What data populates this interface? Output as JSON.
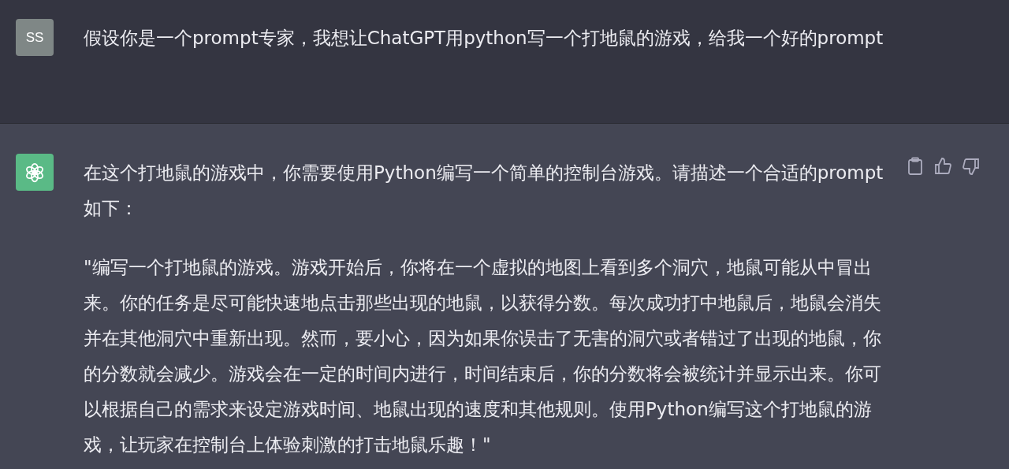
{
  "messages": [
    {
      "kind": "user",
      "avatar": "SS",
      "paragraphs": [
        "假设你是一个prompt专家，我想让ChatGPT用python写一个打地鼠的游戏，给我一个好的prompt"
      ]
    },
    {
      "kind": "assistant",
      "paragraphs": [
        "在这个打地鼠的游戏中，你需要使用Python编写一个简单的控制台游戏。请描述一个合适的prompt如下：",
        "\"编写一个打地鼠的游戏。游戏开始后，你将在一个虚拟的地图上看到多个洞穴，地鼠可能从中冒出来。你的任务是尽可能快速地点击那些出现的地鼠，以获得分数。每次成功打中地鼠后，地鼠会消失并在其他洞穴中重新出现。然而，要小心，因为如果你误击了无害的洞穴或者错过了出现的地鼠，你的分数就会减少。游戏会在一定的时间内进行，时间结束后，你的分数将会被统计并显示出来。你可以根据自己的需求来设定游戏时间、地鼠出现的速度和其他规则。使用Python编写这个打地鼠的游戏，让玩家在控制台上体验刺激的打击地鼠乐趣！\""
      ]
    }
  ]
}
